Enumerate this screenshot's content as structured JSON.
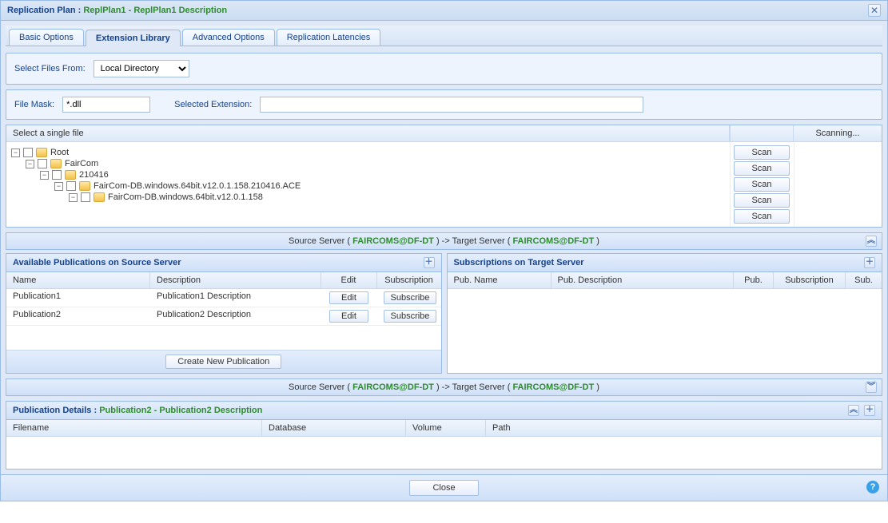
{
  "header": {
    "prefix": "Replication Plan : ",
    "name": "ReplPlan1",
    "sep": " - ",
    "desc": "ReplPlan1 Description"
  },
  "tabs": [
    {
      "id": "basic",
      "label": "Basic Options"
    },
    {
      "id": "extlib",
      "label": "Extension Library"
    },
    {
      "id": "advanced",
      "label": "Advanced Options"
    },
    {
      "id": "latencies",
      "label": "Replication Latencies"
    }
  ],
  "selectFiles": {
    "label": "Select Files From:",
    "value": "Local Directory",
    "options": [
      "Local Directory"
    ]
  },
  "fileMask": {
    "label": "File Mask:",
    "value": "*.dll"
  },
  "selectedExt": {
    "label": "Selected Extension:",
    "value": ""
  },
  "fileTree": {
    "header": "Select a single file",
    "status": "Scanning...",
    "scanBtn": "Scan",
    "nodes": [
      {
        "label": "Root",
        "depth": 0
      },
      {
        "label": "FairCom",
        "depth": 1
      },
      {
        "label": "210416",
        "depth": 2
      },
      {
        "label": "FairCom-DB.windows.64bit.v12.0.1.158.210416.ACE",
        "depth": 3
      },
      {
        "label": "FairCom-DB.windows.64bit.v12.0.1.158",
        "depth": 4
      }
    ]
  },
  "serversBar": {
    "prefixA": "Source Server ( ",
    "serverA": "FAIRCOMS@DF-DT",
    "mid": " ) -> Target Server ( ",
    "serverB": "FAIRCOMS@DF-DT",
    "suffix": " )"
  },
  "avail": {
    "title": "Available Publications on Source Server",
    "headers": {
      "name": "Name",
      "desc": "Description",
      "edit": "Edit",
      "sub": "Subscription"
    },
    "rows": [
      {
        "name": "Publication1",
        "desc": "Publication1 Description",
        "edit": "Edit",
        "sub": "Subscribe"
      },
      {
        "name": "Publication2",
        "desc": "Publication2 Description",
        "edit": "Edit",
        "sub": "Subscribe"
      }
    ],
    "createBtn": "Create New Publication"
  },
  "subs": {
    "title": "Subscriptions on Target Server",
    "headers": {
      "pname": "Pub. Name",
      "pdesc": "Pub. Description",
      "pub": "Pub.",
      "subsc": "Subscription",
      "sub": "Sub."
    }
  },
  "pubDetails": {
    "prefix": "Publication Details : ",
    "name": "Publication2",
    "sep": " - ",
    "desc": "Publication2 Description",
    "headers": {
      "file": "Filename",
      "db": "Database",
      "vol": "Volume",
      "path": "Path"
    }
  },
  "footer": {
    "close": "Close"
  }
}
